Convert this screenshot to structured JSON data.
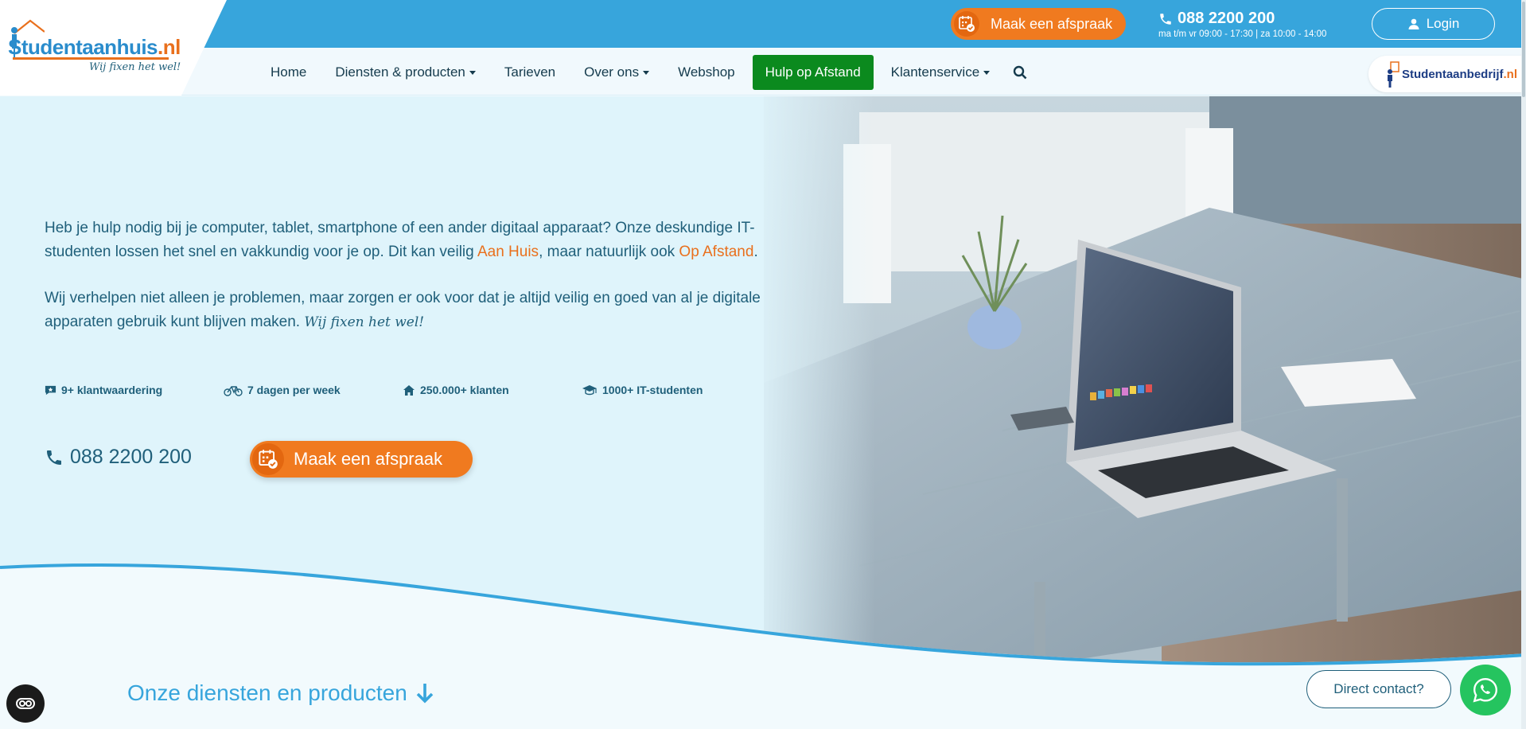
{
  "header": {
    "logo": {
      "brand": "Studentaanhuis",
      "tld": ".nl",
      "slogan": "Wij fixen het wel!"
    },
    "cta_label": "Maak een afspraak",
    "phone": "088 2200 200",
    "hours": "ma t/m vr 09:00 - 17:30 | za 10:00 - 14:00",
    "login_label": "Login"
  },
  "nav": {
    "items": [
      {
        "label": "Home",
        "dropdown": false
      },
      {
        "label": "Diensten & producten",
        "dropdown": true
      },
      {
        "label": "Tarieven",
        "dropdown": false
      },
      {
        "label": "Over ons",
        "dropdown": true
      },
      {
        "label": "Webshop",
        "dropdown": false
      },
      {
        "label": "Hulp op Afstand",
        "dropdown": false,
        "highlight": true
      },
      {
        "label": "Klantenservice",
        "dropdown": true
      }
    ],
    "partner_logo": {
      "brand": "Studentaanbedrijf",
      "tld": ".nl"
    }
  },
  "hero": {
    "p1_start": "Heb je hulp nodig bij je computer, tablet, smartphone of een ander digitaal apparaat? Onze deskundige IT-studenten lossen het snel en vakkundig voor je op. Dit kan veilig ",
    "p1_link1": "Aan Huis",
    "p1_mid": ", maar natuurlijk ook ",
    "p1_link2": "Op Afstand",
    "p1_end": ".",
    "p2": "Wij verhelpen niet alleen je problemen, maar zorgen er ook voor dat je altijd veilig en goed van al je digitale apparaten gebruik kunt blijven maken. ",
    "p2_script": "Wij fixen het wel!",
    "usps": [
      "9+ klantwaardering",
      "7 dagen per week",
      "250.000+ klanten",
      "1000+ IT-studenten"
    ],
    "phone": "088 2200 200",
    "cta_label": "Maak een afspraak"
  },
  "section": {
    "title": "Onze diensten en producten"
  },
  "widgets": {
    "direct_contact": "Direct contact?"
  },
  "colors": {
    "primary_blue": "#37a5dc",
    "accent_orange": "#f07a1f",
    "highlight_green": "#0b8a1e",
    "text_dark": "#1f5f7a"
  }
}
